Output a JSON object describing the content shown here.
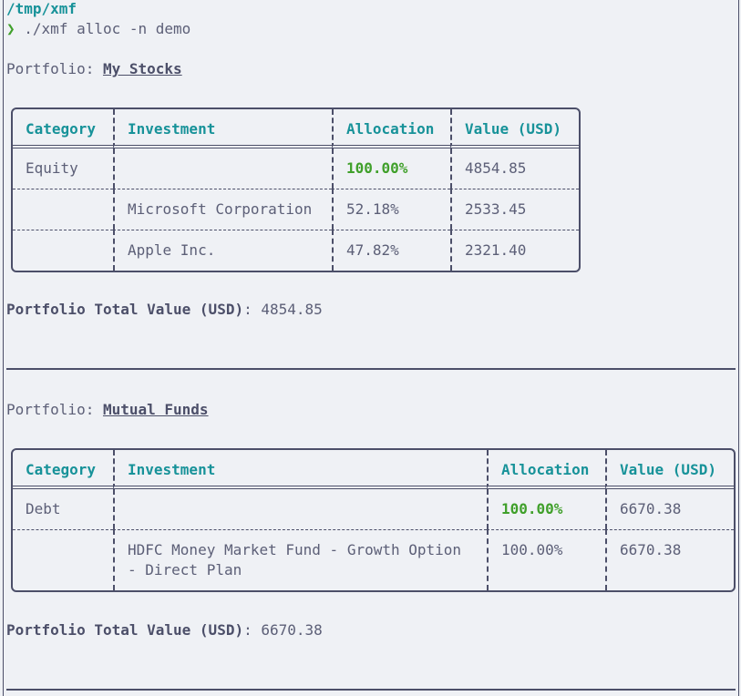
{
  "terminal": {
    "cwd": "/tmp/xmf",
    "prompt_symbol": "❯",
    "command": "./xmf alloc -n demo"
  },
  "portfolio_label": "Portfolio: ",
  "total_label": "Portfolio Total Value (USD)",
  "total_sep": ": ",
  "columns": [
    "Category",
    "Investment",
    "Allocation",
    "Value (USD)"
  ],
  "portfolios": [
    {
      "name": "My Stocks",
      "rows": [
        {
          "category": "Equity",
          "investment": "",
          "allocation": "100.00%",
          "value": "4854.85"
        },
        {
          "category": "",
          "investment": "Microsoft Corporation",
          "allocation": "52.18%",
          "value": "2533.45"
        },
        {
          "category": "",
          "investment": "Apple Inc.",
          "allocation": "47.82%",
          "value": "2321.40"
        }
      ],
      "total": "4854.85"
    },
    {
      "name": "Mutual Funds",
      "rows": [
        {
          "category": "Debt",
          "investment": "",
          "allocation": "100.00%",
          "value": "6670.38"
        },
        {
          "category": "",
          "investment": "HDFC Money Market Fund - Growth Option\n- Direct Plan",
          "allocation": "100.00%",
          "value": "6670.38"
        }
      ],
      "total": "6670.38"
    }
  ],
  "colors": {
    "background": "#eff1f5",
    "text": "#4c4f69",
    "header": "#179299",
    "accent_green": "#40a02b"
  }
}
